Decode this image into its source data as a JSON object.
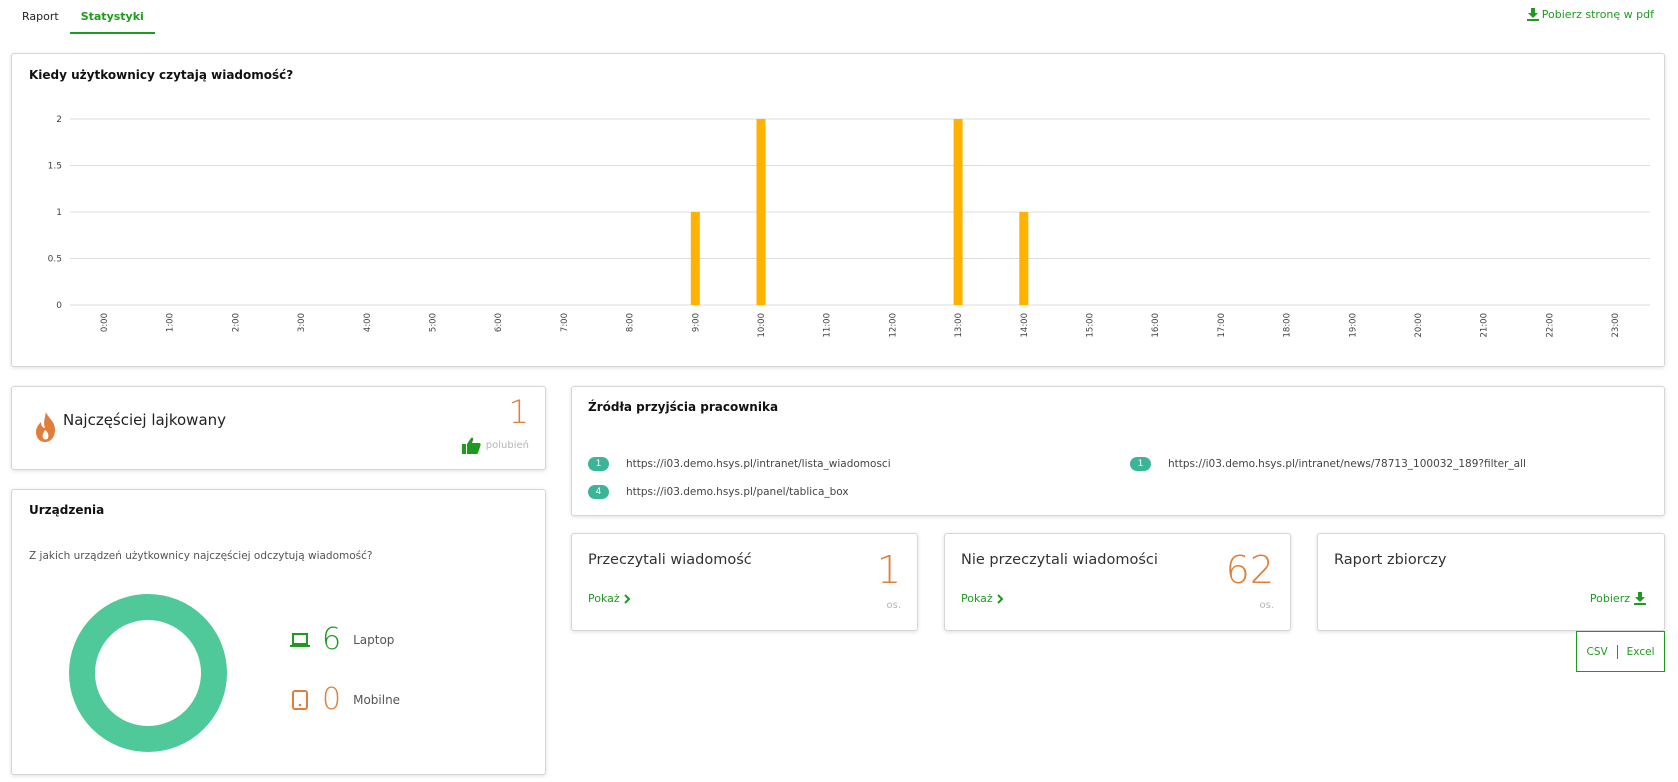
{
  "tabs": [
    {
      "label": "Raport",
      "active": false
    },
    {
      "label": "Statystyki",
      "active": true
    }
  ],
  "pdf_link": "Pobierz stronę w pdf",
  "chart": {
    "title": "Kiedy użytkownicy czytają wiadomość?"
  },
  "chart_data": {
    "type": "bar",
    "title": "Kiedy użytkownicy czytają wiadomość?",
    "categories": [
      "0:00",
      "1:00",
      "2:00",
      "3:00",
      "4:00",
      "5:00",
      "6:00",
      "7:00",
      "8:00",
      "9:00",
      "10:00",
      "11:00",
      "12:00",
      "13:00",
      "14:00",
      "15:00",
      "16:00",
      "17:00",
      "18:00",
      "19:00",
      "20:00",
      "21:00",
      "22:00",
      "23:00"
    ],
    "values": [
      0,
      0,
      0,
      0,
      0,
      0,
      0,
      0,
      0,
      1,
      2,
      0,
      0,
      2,
      1,
      0,
      0,
      0,
      0,
      0,
      0,
      0,
      0,
      0
    ],
    "yticks": [
      "0",
      "0.5",
      "1",
      "1.5",
      "2"
    ],
    "ylim": [
      0,
      2
    ],
    "grid": true,
    "bar_color": "#ffb300"
  },
  "liked": {
    "title": "Najczęściej lajkowany",
    "value": "1",
    "unit": "polubień",
    "icon": "flame-icon",
    "like_icon": "thumbs-up-icon"
  },
  "devices": {
    "title": "Urządzenia",
    "question": "Z jakich urządzeń użytkownicy najczęściej odczytują wiadomość?",
    "laptop": {
      "value": "6",
      "label": "Laptop",
      "color": "#1e9b1e"
    },
    "mobile": {
      "value": "0",
      "label": "Mobilne",
      "color": "#e07e3c"
    },
    "donut_color": "#4fc99a"
  },
  "sources": {
    "title": "Źródła przyjścia pracownika",
    "items": [
      {
        "count": "1",
        "url": "https://i03.demo.hsys.pl/intranet/lista_wiadomosci"
      },
      {
        "count": "1",
        "url": "https://i03.demo.hsys.pl/intranet/news/78713_100032_189?filter_all"
      },
      {
        "count": "4",
        "url": "https://i03.demo.hsys.pl/panel/tablica_box"
      }
    ]
  },
  "read": {
    "title": "Przeczytali wiadomość",
    "link": "Pokaż",
    "value": "1",
    "unit": "os."
  },
  "unread": {
    "title": "Nie przeczytali wiadomości",
    "link": "Pokaż",
    "value": "62",
    "unit": "os."
  },
  "report": {
    "title": "Raport zbiorczy",
    "download": "Pobierz",
    "options": [
      "CSV",
      "Excel"
    ]
  },
  "colors": {
    "accent": "#1e9b1e",
    "orange": "#e07e3c",
    "teal": "#3bb598"
  }
}
